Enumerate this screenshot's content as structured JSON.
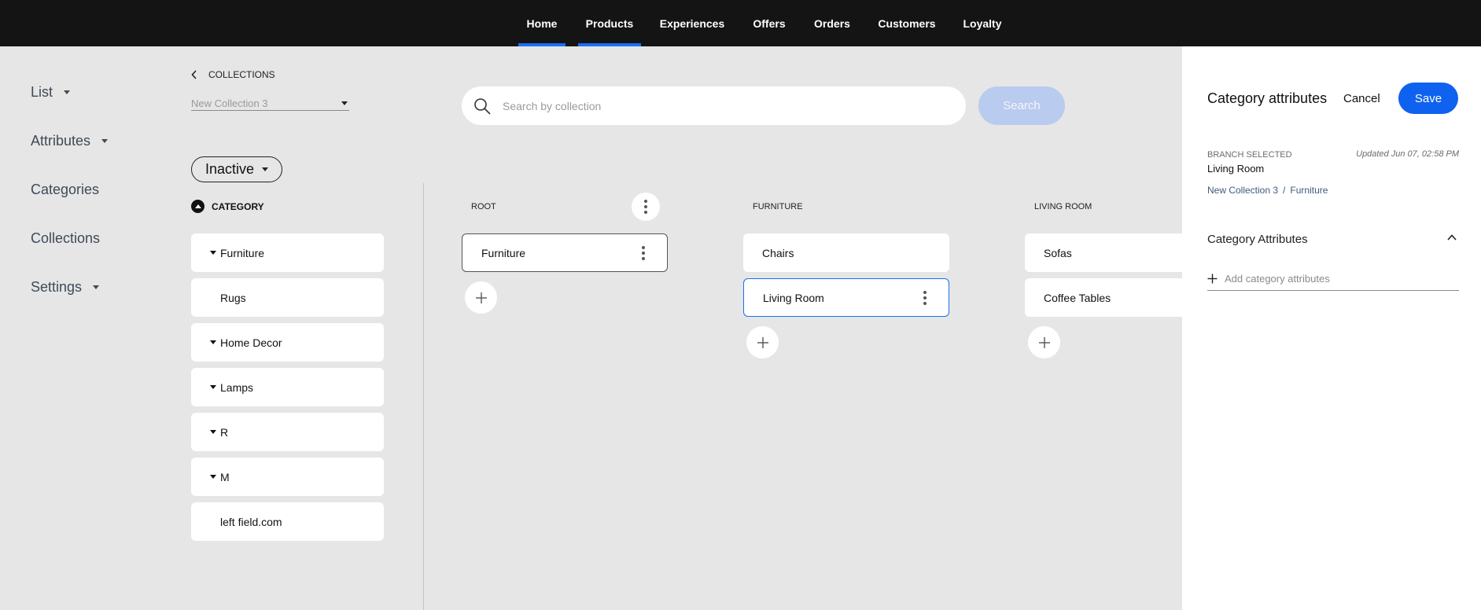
{
  "nav": {
    "items": [
      {
        "label": "Home",
        "active": true
      },
      {
        "label": "Products",
        "active": true
      },
      {
        "label": "Experiences",
        "active": false
      },
      {
        "label": "Offers",
        "active": false
      },
      {
        "label": "Orders",
        "active": false
      },
      {
        "label": "Customers",
        "active": false
      },
      {
        "label": "Loyalty",
        "active": false
      }
    ],
    "accent_color": "#1a6ff5"
  },
  "sidebar": {
    "items": [
      {
        "label": "List",
        "has_dropdown": true
      },
      {
        "label": "Attributes",
        "has_dropdown": true
      },
      {
        "label": "Categories",
        "has_dropdown": false
      },
      {
        "label": "Collections",
        "has_dropdown": false
      },
      {
        "label": "Settings",
        "has_dropdown": true
      }
    ]
  },
  "collections": {
    "back_label": "COLLECTIONS",
    "selected_collection": "New Collection 3"
  },
  "search": {
    "placeholder": "Search by collection",
    "button_label": "Search"
  },
  "status": {
    "value": "Inactive"
  },
  "category_list": {
    "header": "CATEGORY",
    "items": [
      {
        "label": "Furniture",
        "expandable": true
      },
      {
        "label": "Rugs",
        "expandable": false
      },
      {
        "label": "Home Decor",
        "expandable": true
      },
      {
        "label": "Lamps",
        "expandable": true
      },
      {
        "label": "R",
        "expandable": true
      },
      {
        "label": "M",
        "expandable": true
      },
      {
        "label": "left field.com",
        "expandable": false
      }
    ]
  },
  "tree": {
    "columns": [
      {
        "header": "ROOT",
        "nodes": [
          "Furniture"
        ]
      },
      {
        "header": "FURNITURE",
        "nodes": [
          "Chairs",
          "Living Room"
        ]
      },
      {
        "header": "LIVING ROOM",
        "nodes": [
          "Sofas",
          "Coffee Tables"
        ]
      }
    ]
  },
  "panel": {
    "title": "Category attributes",
    "cancel_label": "Cancel",
    "save_label": "Save",
    "branch_label": "BRANCH SELECTED",
    "branch_name": "Living Room",
    "updated": "Updated Jun 07, 02:58 PM",
    "breadcrumb": [
      "New Collection 3",
      "Furniture"
    ],
    "breadcrumb_separator": "/",
    "attributes_title": "Category Attributes",
    "add_attributes_placeholder": "Add category attributes",
    "save_color": "#0f62f0"
  }
}
